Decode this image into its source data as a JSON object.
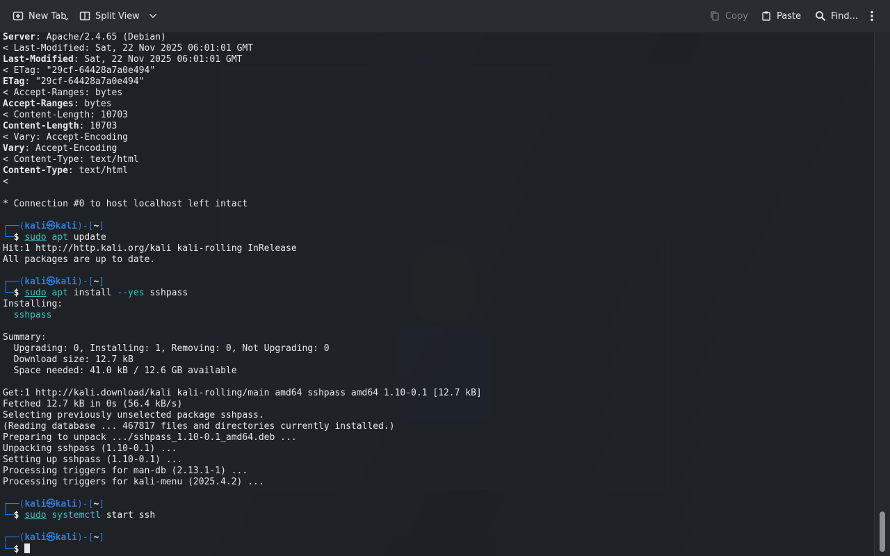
{
  "toolbar": {
    "new_tab_label": "New Tab",
    "split_view_label": "Split View",
    "copy_label": "Copy",
    "paste_label": "Paste",
    "find_label": "Find..."
  },
  "prompt": {
    "user": "kali",
    "host": "kali",
    "dir": "~"
  },
  "terminal_lines": [
    {
      "k": "hdr",
      "key": "Server",
      "val": ": Apache/2.4.65 (Debian)"
    },
    {
      "k": "plain",
      "text": "< Last-Modified: Sat, 22 Nov 2025 06:01:01 GMT"
    },
    {
      "k": "hdr",
      "key": "Last-Modified",
      "val": ": Sat, 22 Nov 2025 06:01:01 GMT"
    },
    {
      "k": "plain",
      "text": "< ETag: \"29cf-64428a7a0e494\""
    },
    {
      "k": "hdr",
      "key": "ETag",
      "val": ": \"29cf-64428a7a0e494\""
    },
    {
      "k": "plain",
      "text": "< Accept-Ranges: bytes"
    },
    {
      "k": "hdr",
      "key": "Accept-Ranges",
      "val": ": bytes"
    },
    {
      "k": "plain",
      "text": "< Content-Length: 10703"
    },
    {
      "k": "hdr",
      "key": "Content-Length",
      "val": ": 10703"
    },
    {
      "k": "plain",
      "text": "< Vary: Accept-Encoding"
    },
    {
      "k": "hdr",
      "key": "Vary",
      "val": ": Accept-Encoding"
    },
    {
      "k": "plain",
      "text": "< Content-Type: text/html"
    },
    {
      "k": "hdr",
      "key": "Content-Type",
      "val": ": text/html"
    },
    {
      "k": "plain",
      "text": "<"
    },
    {
      "k": "plain",
      "text": ""
    },
    {
      "k": "plain",
      "text": "* Connection #0 to host localhost left intact"
    },
    {
      "k": "plain",
      "text": ""
    },
    {
      "k": "p1"
    },
    {
      "k": "p2",
      "sudo": "sudo",
      "cmd": "apt",
      "rest": " update",
      "opt": "",
      "after": ""
    },
    {
      "k": "plain",
      "text": "Hit:1 http://http.kali.org/kali kali-rolling InRelease"
    },
    {
      "k": "plain",
      "text": "All packages are up to date."
    },
    {
      "k": "plain",
      "text": ""
    },
    {
      "k": "p1"
    },
    {
      "k": "p2",
      "sudo": "sudo",
      "cmd": "apt",
      "rest": " install ",
      "opt": "--yes",
      "after": " sshpass"
    },
    {
      "k": "plain",
      "text": "Installing:"
    },
    {
      "k": "pkg",
      "text": "  sshpass"
    },
    {
      "k": "plain",
      "text": ""
    },
    {
      "k": "plain",
      "text": "Summary:"
    },
    {
      "k": "plain",
      "text": "  Upgrading: 0, Installing: 1, Removing: 0, Not Upgrading: 0"
    },
    {
      "k": "plain",
      "text": "  Download size: 12.7 kB"
    },
    {
      "k": "plain",
      "text": "  Space needed: 41.0 kB / 12.6 GB available"
    },
    {
      "k": "plain",
      "text": ""
    },
    {
      "k": "plain",
      "text": "Get:1 http://kali.download/kali kali-rolling/main amd64 sshpass amd64 1.10-0.1 [12.7 kB]"
    },
    {
      "k": "plain",
      "text": "Fetched 12.7 kB in 0s (56.4 kB/s)"
    },
    {
      "k": "plain",
      "text": "Selecting previously unselected package sshpass."
    },
    {
      "k": "plain",
      "text": "(Reading database ... 467817 files and directories currently installed.)"
    },
    {
      "k": "plain",
      "text": "Preparing to unpack .../sshpass_1.10-0.1_amd64.deb ..."
    },
    {
      "k": "plain",
      "text": "Unpacking sshpass (1.10-0.1) ..."
    },
    {
      "k": "plain",
      "text": "Setting up sshpass (1.10-0.1) ..."
    },
    {
      "k": "plain",
      "text": "Processing triggers for man-db (2.13.1-1) ..."
    },
    {
      "k": "plain",
      "text": "Processing triggers for kali-menu (2025.4.2) ..."
    },
    {
      "k": "plain",
      "text": ""
    },
    {
      "k": "p1"
    },
    {
      "k": "p2",
      "sudo": "sudo",
      "cmd": "systemctl",
      "rest": " start ssh",
      "opt": "",
      "after": ""
    },
    {
      "k": "plain",
      "text": ""
    },
    {
      "k": "p1"
    },
    {
      "k": "p2cursor"
    }
  ],
  "colors": {
    "prompt_blue": "#2f7bd6",
    "command_cyan": "#3fbfbf",
    "terminal_text": "#e6e8ea"
  }
}
